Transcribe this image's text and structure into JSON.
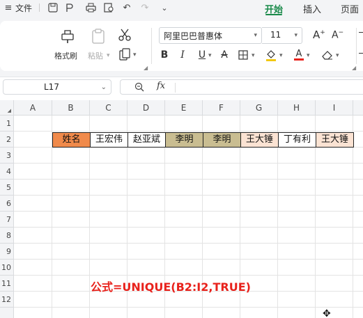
{
  "menubar": {
    "file_label": "文件",
    "tabs": [
      {
        "label": "开始",
        "active": true
      },
      {
        "label": "插入",
        "active": false
      },
      {
        "label": "页面",
        "active": false
      }
    ]
  },
  "ribbon": {
    "format_painter_label": "格式刷",
    "paste_label": "粘贴",
    "font_name": "阿里巴巴普惠体",
    "font_size": "11"
  },
  "formula_bar": {
    "name_box": "L17",
    "fx_label": "fx",
    "formula": ""
  },
  "sheet": {
    "columns": [
      "A",
      "B",
      "C",
      "D",
      "E",
      "F",
      "G",
      "H",
      "I"
    ],
    "rows": [
      "1",
      "2",
      "3",
      "4",
      "5",
      "6",
      "7",
      "8",
      "9",
      "10",
      "11",
      "12"
    ],
    "row2_cells": [
      {
        "col": "B",
        "value": "姓名",
        "fill": "#f08a4b"
      },
      {
        "col": "C",
        "value": "王宏伟",
        "fill": "#ffffff"
      },
      {
        "col": "D",
        "value": "赵亚斌",
        "fill": "#ffffff"
      },
      {
        "col": "E",
        "value": "李明",
        "fill": "#c9bd91"
      },
      {
        "col": "F",
        "value": "李明",
        "fill": "#c9bd91"
      },
      {
        "col": "G",
        "value": "王大锤",
        "fill": "#fbe3d3"
      },
      {
        "col": "H",
        "value": "丁有利",
        "fill": "#ffffff"
      },
      {
        "col": "I",
        "value": "王大锤",
        "fill": "#fbe3d3"
      }
    ],
    "note": "公式=UNIQUE(B2:I2,TRUE)",
    "note_color": "#e8221c"
  },
  "colors": {
    "accent": "#1a8a4a"
  }
}
